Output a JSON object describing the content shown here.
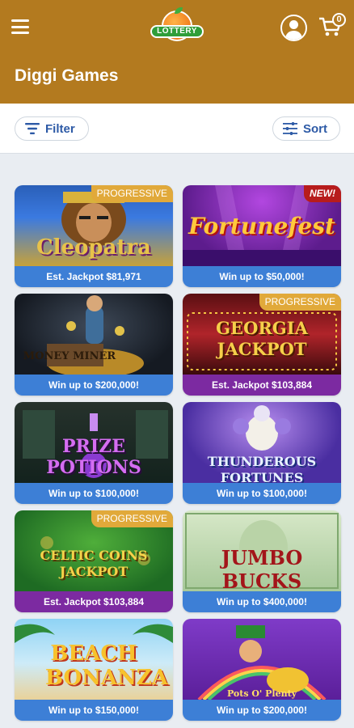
{
  "header": {
    "title": "Diggi Games",
    "logo_text": "LOTTERY",
    "cart_count": "0",
    "color": "#b37a1f"
  },
  "toolbar": {
    "filter_label": "Filter",
    "sort_label": "Sort"
  },
  "games": [
    {
      "title": "Cleopatra",
      "caption": "Est. Jackpot $81,971",
      "badge": "PROGRESSIVE"
    },
    {
      "title": "Fortunefest",
      "caption": "Win up to $50,000!",
      "badge": "NEW!"
    },
    {
      "title": "MONEY MINER",
      "caption": "Win up to $200,000!"
    },
    {
      "title": "GEORGIA JACKPOT",
      "caption": "Est. Jackpot $103,884",
      "badge": "PROGRESSIVE"
    },
    {
      "title": "PRIZE POTIONS",
      "caption": "Win up to $100,000!"
    },
    {
      "title": "THUNDEROUS FORTUNES",
      "caption": "Win up to $100,000!"
    },
    {
      "title": "CELTIC COINS JACKPOT",
      "caption": "Est. Jackpot $103,884",
      "badge": "PROGRESSIVE"
    },
    {
      "title": "JUMBO BUCKS",
      "caption": "Win up to $400,000!"
    },
    {
      "title": "BEACH BONANZA",
      "caption": "Win up to $150,000!"
    },
    {
      "title": "Pots O' Plenty",
      "caption": "Win up to $200,000!"
    }
  ]
}
